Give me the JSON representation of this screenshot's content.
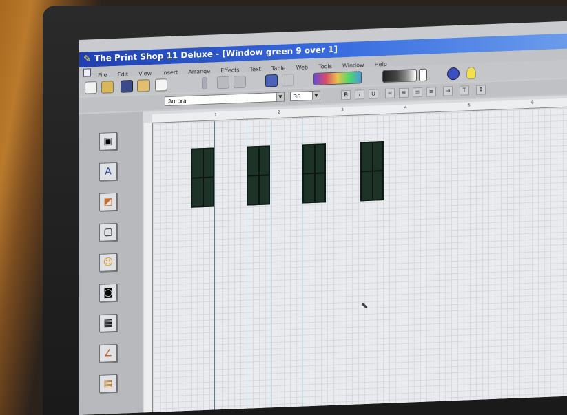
{
  "app": {
    "title": "The Print Shop 11 Deluxe - [Window green 9 over 1]"
  },
  "menu": [
    "File",
    "Edit",
    "View",
    "Insert",
    "Arrange",
    "Effects",
    "Text",
    "Table",
    "Web",
    "Tools",
    "Window",
    "Help"
  ],
  "format_bar": {
    "font_name": "Aurora",
    "font_size": "36"
  },
  "ruler_numbers": [
    "1",
    "2",
    "3",
    "4",
    "5",
    "6"
  ],
  "tools": [
    {
      "name": "photo-tool-icon",
      "glyph": "▣"
    },
    {
      "name": "text-tool-icon",
      "glyph": "A"
    },
    {
      "name": "headline-tool-icon",
      "glyph": "◩"
    },
    {
      "name": "frame-tool-icon",
      "glyph": "▢"
    },
    {
      "name": "smiley-clipart-icon",
      "glyph": "☺"
    },
    {
      "name": "camera-tool-icon",
      "glyph": "◙"
    },
    {
      "name": "table-tool-icon",
      "glyph": "▦"
    },
    {
      "name": "line-tool-icon",
      "glyph": "∠"
    },
    {
      "name": "book-tool-icon",
      "glyph": "▤"
    }
  ],
  "colors": {
    "title_bar": "#2a55c8",
    "window_panel": "#1d3328"
  }
}
